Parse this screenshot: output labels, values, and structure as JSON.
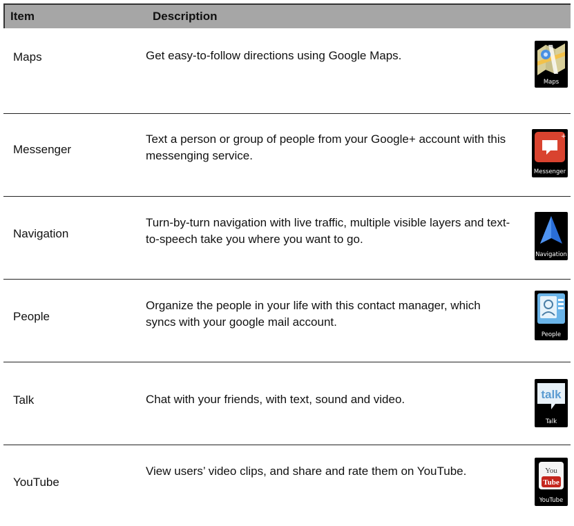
{
  "header": {
    "item": "Item",
    "description": "Description"
  },
  "rows": [
    {
      "name": "Maps",
      "description": "Get easy-to-follow directions using Google Maps.",
      "icon": "maps-icon",
      "icon_label": "Maps"
    },
    {
      "name": "Messenger",
      "description": "Text a person or group of people from your Google+ account with this messenging service.",
      "icon": "messenger-icon",
      "icon_label": "Messenger"
    },
    {
      "name": "Navigation",
      "description": "Turn-by-turn navigation with live traffic, multiple visible layers and text-to-speech take you where you want to go.",
      "icon": "navigation-icon",
      "icon_label": "Navigation"
    },
    {
      "name": "People",
      "description": "Organize the people in your life with this contact manager, which syncs with your google mail account.",
      "icon": "people-icon",
      "icon_label": "People"
    },
    {
      "name": "Talk",
      "description": "Chat with your friends, with text, sound and video.",
      "icon": "talk-icon",
      "icon_label": "Talk",
      "icon_text": "talk"
    },
    {
      "name": "YouTube",
      "description": "View users’ video clips, and share and rate them on YouTube.",
      "icon": "youtube-icon",
      "icon_label": "YouTube",
      "icon_text_top": "You",
      "icon_text_bottom": "Tube"
    }
  ]
}
